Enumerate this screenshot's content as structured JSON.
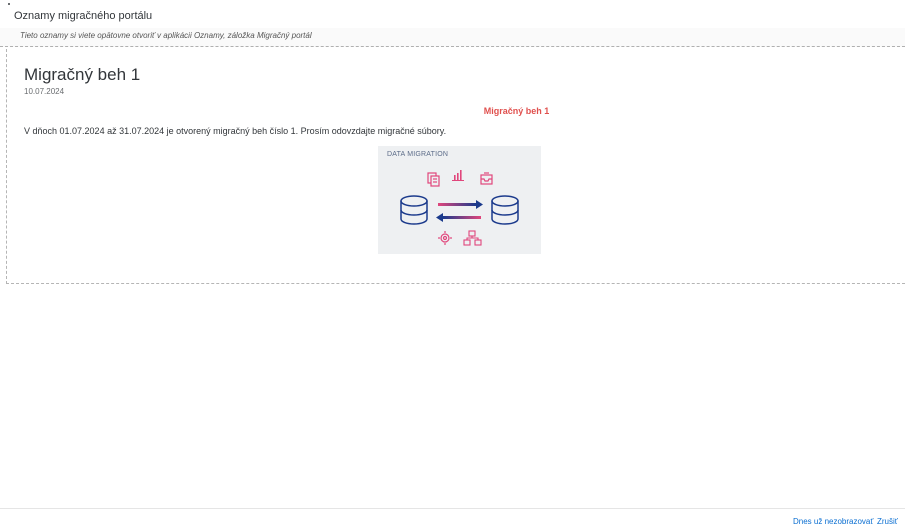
{
  "dialog": {
    "title": "Oznamy migračného portálu",
    "subheader": "Tieto oznamy si viete opätovne otvoriť v aplikácii Oznamy, záložka Migračný portál"
  },
  "announcement": {
    "title": "Migračný beh 1",
    "date": "10.07.2024",
    "highlight": "Migračný beh 1",
    "body": "V dňoch 01.07.2024 až 31.07.2024 je otvorený migračný beh číslo 1. Prosím odovzdajte migračné súbory.",
    "image_caption": "DATA MIGRATION"
  },
  "footer": {
    "dont_show_today": "Dnes už nezobrazovať",
    "cancel": "Zrušiť"
  },
  "colors": {
    "accent_red": "#e0504e",
    "link_blue": "#0a6ed1",
    "icon_pink": "#e0467c",
    "icon_navy": "#1b3a8c"
  },
  "icons": [
    "document-icon",
    "chart-icon",
    "inbox-icon",
    "database-icon",
    "arrow-right-icon",
    "arrow-left-icon",
    "gear-icon",
    "hierarchy-icon"
  ]
}
